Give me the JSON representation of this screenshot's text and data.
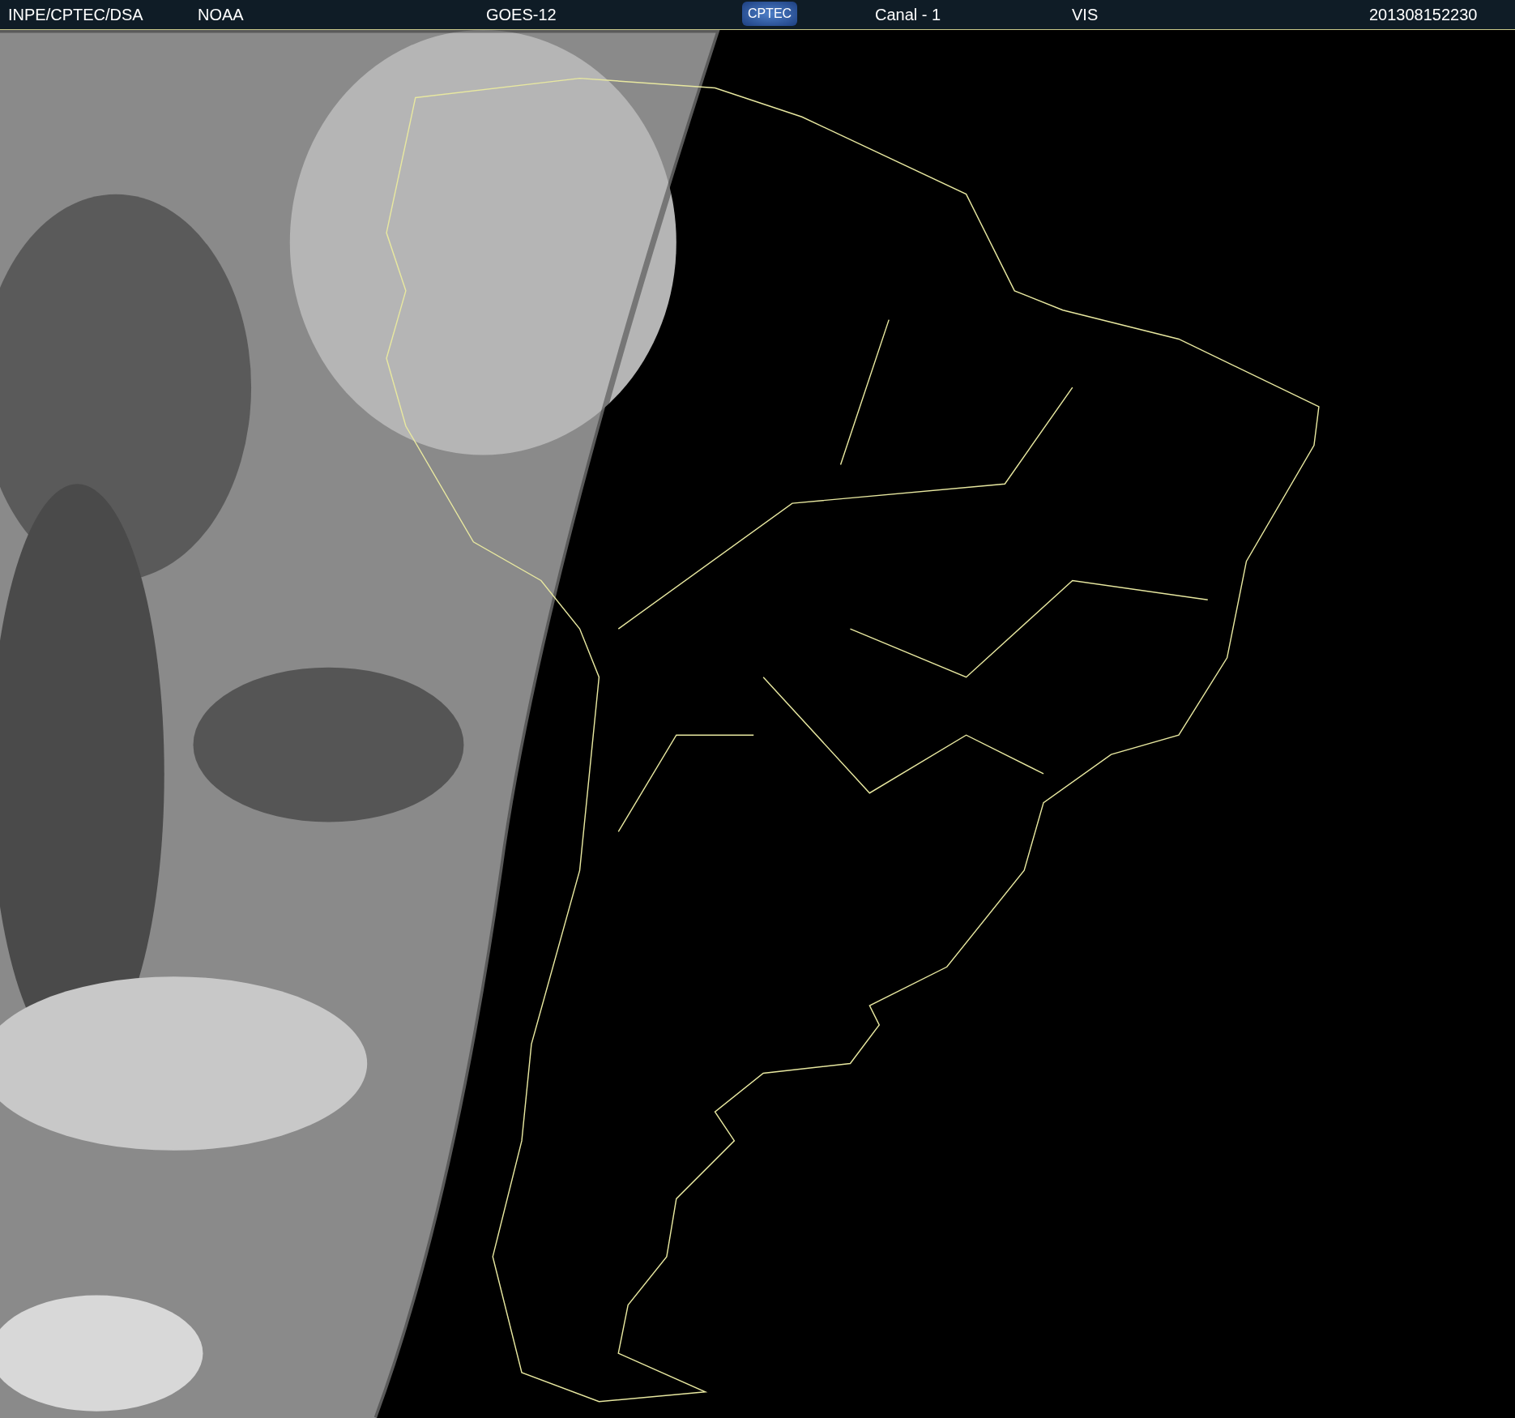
{
  "header": {
    "items": [
      {
        "kind": "text",
        "text": "INPE/CPTEC/DSA"
      },
      {
        "kind": "text",
        "text": "NOAA"
      },
      {
        "kind": "text",
        "text": "GOES-12"
      },
      {
        "kind": "logo",
        "text": "CPTEC"
      },
      {
        "kind": "text",
        "text": "Canal - 1"
      },
      {
        "kind": "text",
        "text": "VIS"
      },
      {
        "kind": "text",
        "text": "201308152230"
      }
    ]
  }
}
